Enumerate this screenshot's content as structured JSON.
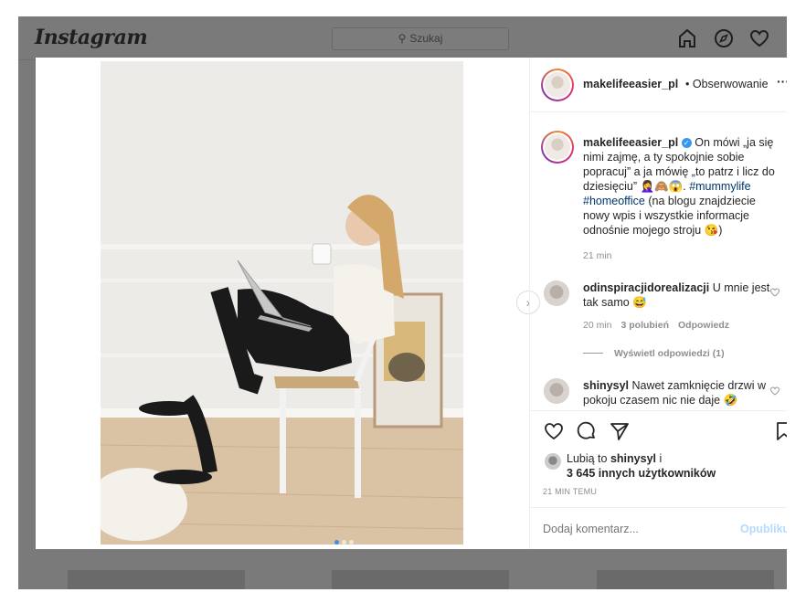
{
  "app": {
    "logo": "Instagram",
    "search_placeholder": "Szukaj"
  },
  "post": {
    "username": "makelifeeasier_pl",
    "follow_label": "• Obserwowanie",
    "more": "···",
    "caption_user": "makelifeeasier_pl",
    "caption_text": "On mówi „ja się nimi zajmę, a ty spokojnie sobie popracuj” a ja mówię „to patrz i licz do dziesięciu” 🤦‍♀️🙈😱.",
    "caption_tag1": "#mummylife",
    "caption_tag2": "#homeoffice",
    "caption_tail": "(na blogu znajdziecie nowy wpis i wszystkie informacje odnośnie mojego stroju 😘)",
    "caption_time": "21 min",
    "photo_count": 3,
    "photo_index": 1
  },
  "comments": [
    {
      "user": "odinspiracjidorealizacji",
      "text": "U mnie jest tak samo 😅",
      "time": "20 min",
      "likes": "3 polubień",
      "reply": "Odpowiedz",
      "view_replies": "Wyświetl odpowiedzi (1)"
    },
    {
      "user": "shinysyl",
      "text": "Nawet zamknięcie drzwi w pokoju czasem nic nie daje 🤣"
    }
  ],
  "likes": {
    "prefix": "Lubią to",
    "user": "shinysyl",
    "suffix": "i",
    "others": "3 645 innych użytkowników"
  },
  "time_ago": "21 MIN TEMU",
  "comment_box": {
    "placeholder": "Dodaj komentarz...",
    "post_label": "Opublikuj"
  },
  "icons": [
    "home-icon",
    "explore-icon",
    "heart-icon",
    "comment-icon",
    "share-icon",
    "bookmark-icon",
    "search-icon",
    "chevron-right-icon"
  ]
}
